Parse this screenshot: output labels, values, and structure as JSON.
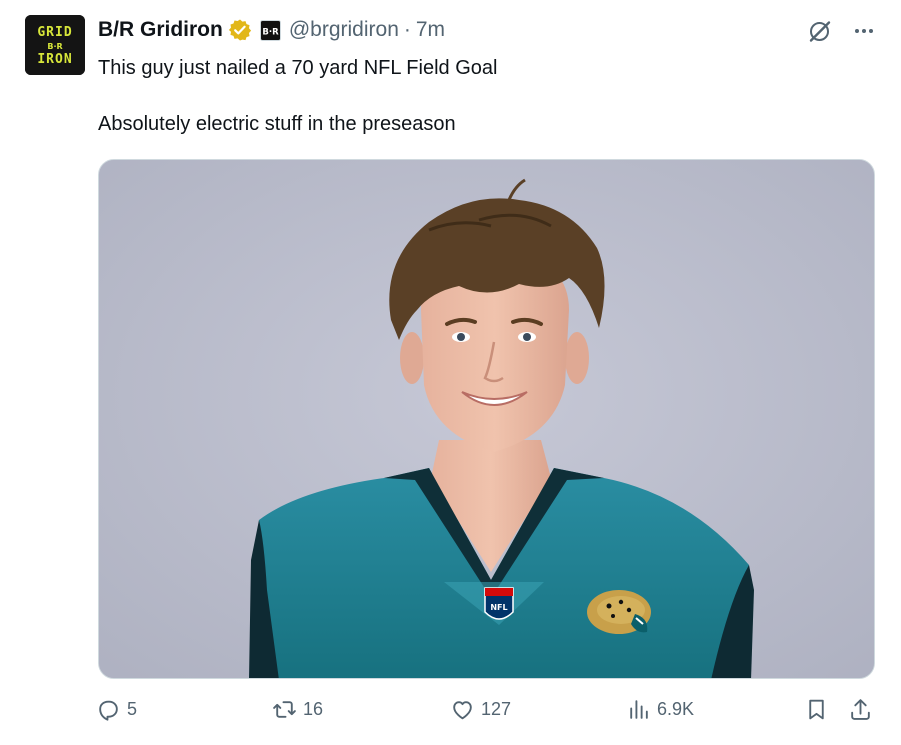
{
  "tweet": {
    "author": {
      "avatar_text": [
        "GRID",
        "B·R",
        "IRON"
      ],
      "display_name": "B/R Gridiron",
      "handle": "@brgridiron",
      "separator": "·",
      "time": "7m",
      "affiliate_badge_text": "B·R",
      "verified_color": "#e2b719"
    },
    "body": {
      "line1": "This guy just nailed a 70 yard NFL Field Goal",
      "line2": "Absolutely electric stuff in the preseason"
    },
    "media": {
      "jersey_shield_text": "NFL",
      "colors": {
        "background": "#b9bccb",
        "jersey": "#1f7f93",
        "hair": "#5a4026"
      }
    },
    "actions": {
      "replies": "5",
      "reposts": "16",
      "likes": "127",
      "views": "6.9K"
    },
    "icons": {
      "grok": "grok-icon",
      "more": "more-icon",
      "reply": "reply-icon",
      "repost": "repost-icon",
      "like": "heart-icon",
      "views": "views-icon",
      "bookmark": "bookmark-icon",
      "share": "share-icon"
    }
  }
}
